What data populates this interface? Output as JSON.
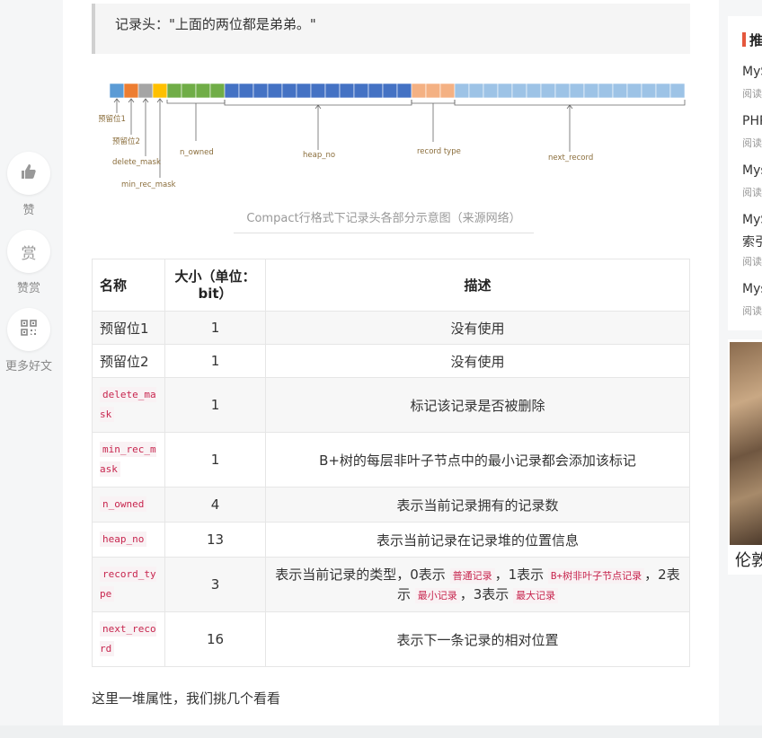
{
  "left_rail": {
    "like_label": "赞",
    "reward_icon_text": "赏",
    "reward_label": "赞赏",
    "more_label": "更多好文"
  },
  "quote": {
    "text": "记录头：\"上面的两位都是弟弟。\""
  },
  "figure": {
    "labels": {
      "reserved1": "预留位1",
      "reserved2": "预留位2",
      "delete_mask": "delete_mask",
      "min_rec_mask": "min_rec_mask",
      "n_owned": "n_owned",
      "heap_no": "heap_no",
      "record_type": "record type",
      "next_record": "next_record"
    },
    "caption": "Compact行格式下记录头各部分示意图（来源网络）",
    "colors": {
      "reserved1": "#5b9bd5",
      "reserved2": "#ed7d31",
      "delete_mask": "#a5a5a5",
      "min_rec_mask": "#ffc000",
      "n_owned": "#70ad47",
      "heap_no": "#4472c4",
      "record_type": "#f4b183",
      "next_record": "#9dc3e6"
    }
  },
  "table": {
    "headers": {
      "name": "名称",
      "size": "大小（单位：bit）",
      "desc": "描述"
    },
    "rows": [
      {
        "name": "预留位1",
        "size": "1",
        "desc": "没有使用"
      },
      {
        "name": "预留位2",
        "size": "1",
        "desc": "没有使用"
      },
      {
        "name": "delete_mask",
        "size": "1",
        "desc": "标记该记录是否被删除"
      },
      {
        "name": "min_rec_mask",
        "size": "1",
        "desc": "B+树的每层非叶子节点中的最小记录都会添加该标记"
      },
      {
        "name": "n_owned",
        "size": "4",
        "desc": "表示当前记录拥有的记录数"
      },
      {
        "name": "heap_no",
        "size": "13",
        "desc": "表示当前记录在记录堆的位置信息"
      },
      {
        "name": "record_type",
        "size": "3",
        "desc_parts": {
          "p1": "表示当前记录的类型，0表示",
          "c1": "普通记录",
          "p2": "，1表示",
          "c2": "B+树非叶子节点记录",
          "p3": "，2表示",
          "c3": "最小记录",
          "p4": "，3表示",
          "c4": "最大记录"
        }
      },
      {
        "name": "next_record",
        "size": "16",
        "desc": "表示下一条记录的相对位置"
      }
    ]
  },
  "after_text": "这里一堆属性，我们挑几个看看",
  "right_panel": {
    "heading": "推",
    "items": [
      {
        "title": "MyS",
        "meta": "阅读"
      },
      {
        "title": "PHP",
        "meta": "阅读"
      },
      {
        "title": "Mys",
        "meta": "阅读"
      },
      {
        "title": "MyS",
        "title2": "索引",
        "meta": "阅读"
      },
      {
        "title": "Mys",
        "meta": "阅读"
      }
    ]
  },
  "right_ad": {
    "text": "伦敦"
  }
}
